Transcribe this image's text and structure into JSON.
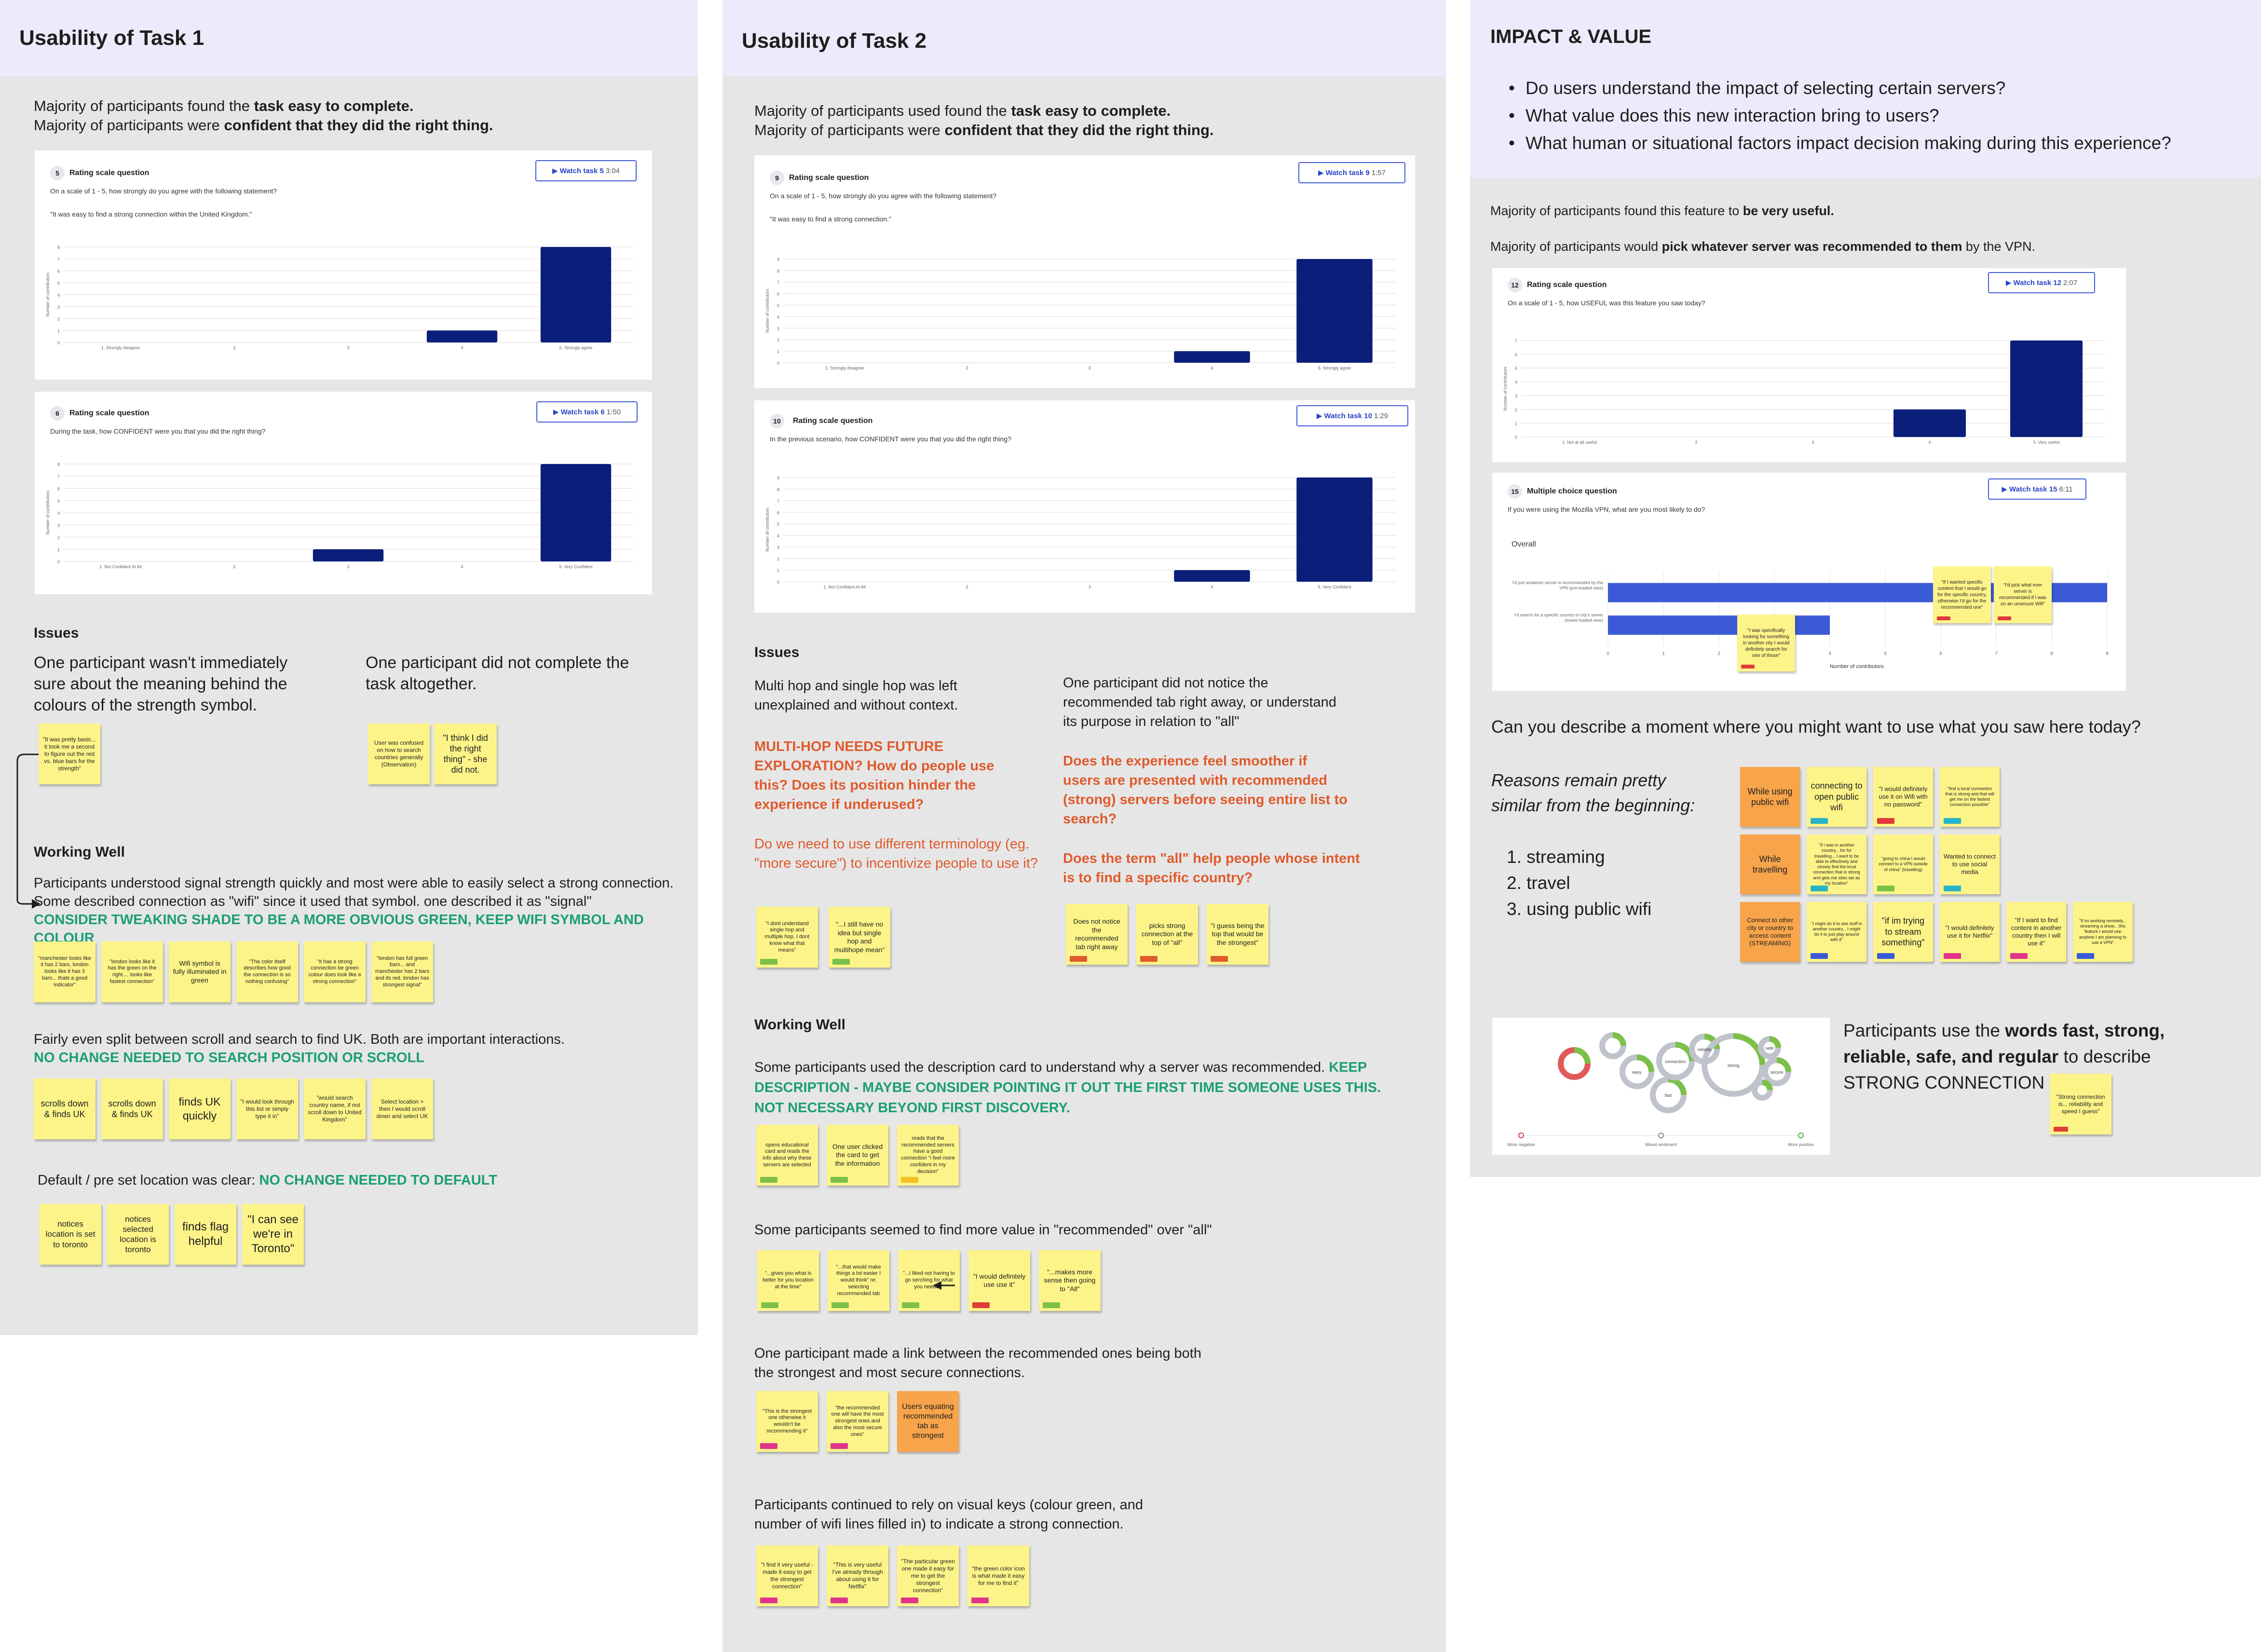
{
  "colors": {
    "frame_bg": "#e6e6e6",
    "header_bg": "#ebebfb",
    "bar": "#0b1e7a",
    "hbar": "#3b5bd6",
    "sticky": "#fdf489",
    "sticky_orange": "#f7a44b",
    "accent_green": "#1b9e74",
    "accent_red": "#e05a2c"
  },
  "task1": {
    "title": "Usability of Task 1",
    "intro1_a": "Majority of participants found the ",
    "intro1_b": "task easy to complete.",
    "intro2_a": "Majority of participants were ",
    "intro2_b": "confident that they did the right thing.",
    "q5": {
      "num": "5",
      "title": "Rating scale question",
      "question": "On a scale of 1 - 5, how strongly do you agree with the following statement?",
      "statement": "\"It was easy to find a strong connection within the United Kingdom.\"",
      "watch_label": "Watch task 5",
      "duration": "3:04"
    },
    "q6": {
      "num": "6",
      "title": "Rating scale question",
      "question": "During the task, how CONFIDENT were you that you did the right thing?",
      "watch_label": "Watch task 6",
      "duration": "1:50"
    },
    "issues_heading": "Issues",
    "issue1": "One participant wasn't immediately sure about the meaning behind the colours of the strength symbol.",
    "issue2": "One participant did not complete the task altogether.",
    "issue_stickies": [
      "\"It was pretty basic... it took me a second to figure out the red vs. blue bars for the strength\"",
      "User was confused on how to search countries generally (Observation)",
      "\"I think I did the right thing\" - she did not."
    ],
    "working_heading": "Working Well",
    "ww1": "Participants understood signal strength quickly and most were able to easily select a strong connection. Some described connection as \"wifi\" since it used that symbol. one described it as \"signal\"",
    "ww1_rec": "CONSIDER TWEAKING SHADE TO BE A MORE OBVIOUS GREEN, KEEP WIFI SYMBOL AND COLOUR",
    "ww1_stickies": [
      "\"manchester looks like it has 2 bars, london looks like it has 3 bars... thats a good indicator\"",
      "\"london looks like it has the green on the right.... looks like fastest connection\"",
      "Wifi symbol is fully illuminated in green",
      "\"The color itself describes how good the connection is so nothing confusing\"",
      "\"It has a strong connection be green colour does look like a strong connection\"",
      "\"london has full green bars... and manchester has 2 bars and its red. london has strongest signal\""
    ],
    "ww2": "Fairly even split between scroll and search to find UK. Both are important interactions.",
    "ww2_rec": "NO CHANGE NEEDED TO SEARCH POSITION OR SCROLL",
    "ww2_stickies": [
      "scrolls down & finds UK",
      "scrolls down & finds UK",
      "finds UK quickly",
      "\"I would look through this list or simply type it in\"",
      "\"would search country name, if not scroll down to United Kingdom\"",
      "Select location > then I would scroll down and select UK"
    ],
    "ww3": "Default / pre set location was clear: ",
    "ww3_rec": "NO CHANGE NEEDED TO DEFAULT",
    "ww3_stickies": [
      "notices location is set to toronto",
      "notices selected location is toronto",
      "finds flag helpful",
      "\"I can see we're in Toronto\""
    ]
  },
  "task2": {
    "title": "Usability of Task 2",
    "intro1_a": "Majority of participants used found the ",
    "intro1_b": "task easy to complete.",
    "intro2_a": "Majority of participants were ",
    "intro2_b": "confident that they did the right thing.",
    "q9": {
      "num": "9",
      "title": "Rating scale question",
      "question": "On a scale of 1 - 5, how strongly do you agree with the following statement?",
      "statement": "\"It was easy to find a strong connection.\"",
      "watch_label": "Watch task 9",
      "duration": "1:57"
    },
    "q10": {
      "num": "10",
      "title": "Rating scale question",
      "question": "In the previous scenario, how CONFIDENT were you that you did the right thing?",
      "watch_label": "Watch task 10",
      "duration": "1:29"
    },
    "issues_heading": "Issues",
    "issue1": "Multi hop and single hop was left unexplained and without context.",
    "issue1_rec1": "MULTI-HOP NEEDS FUTURE EXPLORATION? How do people use this? Does its position hinder the experience if underused?",
    "issue1_rec2": "Do we need to use different terminology (eg. \"more secure\") to incentivize people to use it?",
    "issue1_stickies": [
      "\"I dont understand single hop and multiple hop, I dont know what that means\"",
      "\"...I still have no idea but single hop and multihope mean\""
    ],
    "issue2": "One participant did not notice the recommended tab right away, or understand its purpose in relation to \"all\"",
    "issue2_rec1": "Does the experience feel smoother if users are presented with recommended (strong) servers before seeing entire list to search?",
    "issue2_rec2": "Does the term \"all\" help people whose intent is to find a specific country?",
    "issue2_stickies": [
      "Does not notice the recommended tab right away",
      "picks strong connection at the top of \"all\"",
      "\"I guess being the top that would be the strongest\""
    ],
    "working_heading": "Working Well",
    "ww1": "Some participants used the description card to understand why a server was recommended. ",
    "ww1_rec": "KEEP DESCRIPTION - MAYBE CONSIDER POINTING IT OUT THE FIRST TIME SOMEONE USES THIS. NOT NECESSARY BEYOND FIRST DISCOVERY.",
    "ww1_stickies": [
      "opens educational card and reads the info about why these servers are selected",
      "One user clicked the card to get the information",
      "reads that the recommended servers have a good connection \"i feel more confident in my decision\""
    ],
    "ww2": "Some participants seemed to find more value in \"recommended\" over \"all\"",
    "ww2_stickies": [
      "\"...gives you what is better for you location at the time\"",
      "\"...that would make things a lot easier I would think\" re: selecting recommended tab",
      "\"...I liked not having to go serching for what you needed\"",
      "\"I would definitely use use it\"",
      "\"...makes more sense then going to \"All\""
    ],
    "ww3": "One participant made a link between the recommended ones being both the strongest and most secure connections.",
    "ww3_stickies": [
      "\"This is the strongest one otherwise it wouldn't be recommending it\"",
      "\"the recommended one will have the most strongest ones and also the most secure ones\"",
      "Users equating recommended tab as strongest"
    ],
    "ww4": "Participants continued to rely on visual keys (colour green, and number of wifi lines filled in) to indicate a strong connection.",
    "ww4_stickies": [
      "\"I find it very useful - made it easy to get the strongest connection\"",
      "\"This is very useful I've already through about using it for Netflix\"",
      "\"The particular green one made it easy for me to get the strongest connection\"",
      "\"the green color icon is what made it easy for me to find it\""
    ]
  },
  "impact": {
    "title": "IMPACT & VALUE",
    "questions": [
      "Do users understand the impact of selecting certain servers?",
      "What value does this new interaction bring to users?",
      "What human or situational factors impact decision making during this experience?"
    ],
    "find1_a": "Majority of participants found this feature to ",
    "find1_b": "be very useful.",
    "find2_a": "Majority of participants would ",
    "find2_b": "pick whatever server was recommended to them",
    "find2_c": " by the VPN.",
    "q12": {
      "num": "12",
      "title": "Rating scale question",
      "question": "On a scale of 1 - 5, how USEFUL was this feature you saw today?",
      "watch_label": "Watch task 12",
      "duration": "2:07"
    },
    "q15": {
      "num": "15",
      "title": "Multiple choice question",
      "question": "If you were using the Mozilla VPN, what are you most likely to do?",
      "watch_label": "Watch task 15",
      "duration": "6:11",
      "overall": "Overall",
      "xlabel": "Number of contributors"
    },
    "q15_notes": [
      "\"If I wanted specific content that I would go for the specific country, otherwise I'd go for the recommended one\"",
      "\"I'd pick what ever server is recommended if I was on an unsecure Wifi\"",
      "\"I was specifically looking for something in another city I would definitely search for one of those\""
    ],
    "moment_q": "Can you describe a moment where you might want to use what you saw here today?",
    "reasons": "Reasons remain pretty similar from the beginning:",
    "reason_list": [
      "1. streaming",
      "2. travel",
      "3. using public wifi"
    ],
    "moment_stickies": [
      {
        "text": "While using public wifi",
        "orange": true
      },
      {
        "text": "connecting to open public wifi",
        "orange": false
      },
      {
        "text": "\"I would definitely use it on Wifi with no password\"",
        "orange": false
      },
      {
        "text": "\"find a local connection that is strong and that will get me on the fastest connection possible\"",
        "orange": false
      },
      {
        "text": "While travelling",
        "orange": true
      },
      {
        "text": "\"If i was in another country... for for travelling... I want to be able to effectively and closely find the local connection that is strong and gets me sites set as my location\"",
        "orange": false
      },
      {
        "text": "\"going to china I would connect to a VPN outside of china\" (travelling)",
        "orange": false
      },
      {
        "text": "Wanted to connect to use social media",
        "orange": false
      },
      {
        "text": "Connect to other city or country to access content (STREAMING)",
        "orange": true
      },
      {
        "text": "\"I might do it to see stuff in another country... I might do it to just play around with it\"",
        "orange": false
      },
      {
        "text": "\"if im trying to stream something\"",
        "orange": false
      },
      {
        "text": "\"I would definitely use it for Netflix\"",
        "orange": false
      },
      {
        "text": "\"If I want to find content in another country then I will use it\"",
        "orange": false
      },
      {
        "text": "\"If im working remotely... streaming a show... this feature I would use anytime I am planning to use a VPN\"",
        "orange": false
      }
    ],
    "words_a": "Participants use the ",
    "words_b": "words fast, strong, reliable, safe, and regular",
    "words_c": " to describe STRONG CONNECTION",
    "words_sticky": "\"Strong connection is... reliability and speed I guess\"",
    "bubble_legend": [
      "More negative",
      "Mixed sentiment",
      "More positive"
    ],
    "bubbles": [
      "strong",
      "fast",
      "easy",
      "connection",
      "reliable",
      "secure",
      "safe"
    ]
  },
  "chart_data": [
    {
      "type": "bar",
      "id": "q5",
      "categories": [
        "1. Strongly disagree",
        "2",
        "3",
        "4",
        "5. Strongly agree"
      ],
      "values": [
        0,
        0,
        0,
        1,
        8
      ],
      "ylim": [
        0,
        8
      ],
      "ylabel": "Number of contributors"
    },
    {
      "type": "bar",
      "id": "q6",
      "categories": [
        "1. Not Confident At All",
        "2",
        "3",
        "4",
        "5. Very Confident"
      ],
      "values": [
        0,
        0,
        1,
        0,
        8
      ],
      "ylim": [
        0,
        8
      ],
      "ylabel": "Number of contributors"
    },
    {
      "type": "bar",
      "id": "q9",
      "categories": [
        "1. Strongly disagree",
        "2",
        "3",
        "4",
        "5. Strongly agree"
      ],
      "values": [
        0,
        0,
        0,
        1,
        9
      ],
      "ylim": [
        0,
        9
      ],
      "ylabel": "Number of contributors"
    },
    {
      "type": "bar",
      "id": "q10",
      "categories": [
        "1. Not Confident At All",
        "2",
        "3",
        "4",
        "5. Very Confident"
      ],
      "values": [
        0,
        0,
        0,
        1,
        9
      ],
      "ylim": [
        0,
        9
      ],
      "ylabel": "Number of contributors"
    },
    {
      "type": "bar",
      "id": "q12",
      "categories": [
        "1. Not at all useful",
        "2",
        "3",
        "4",
        "5. Very useful"
      ],
      "values": [
        0,
        0,
        0,
        2,
        7
      ],
      "ylim": [
        0,
        7
      ],
      "ylabel": "Number of contributors"
    },
    {
      "type": "hbar",
      "id": "q15",
      "categories": [
        "I'd just whatever server is recommended by the VPN (pre-loaded view)",
        "I'd search for a specific country or city's server (mixed loaded view)"
      ],
      "values": [
        9,
        4
      ],
      "xlim": [
        0,
        9
      ],
      "xlabel": "Number of contributors"
    }
  ]
}
